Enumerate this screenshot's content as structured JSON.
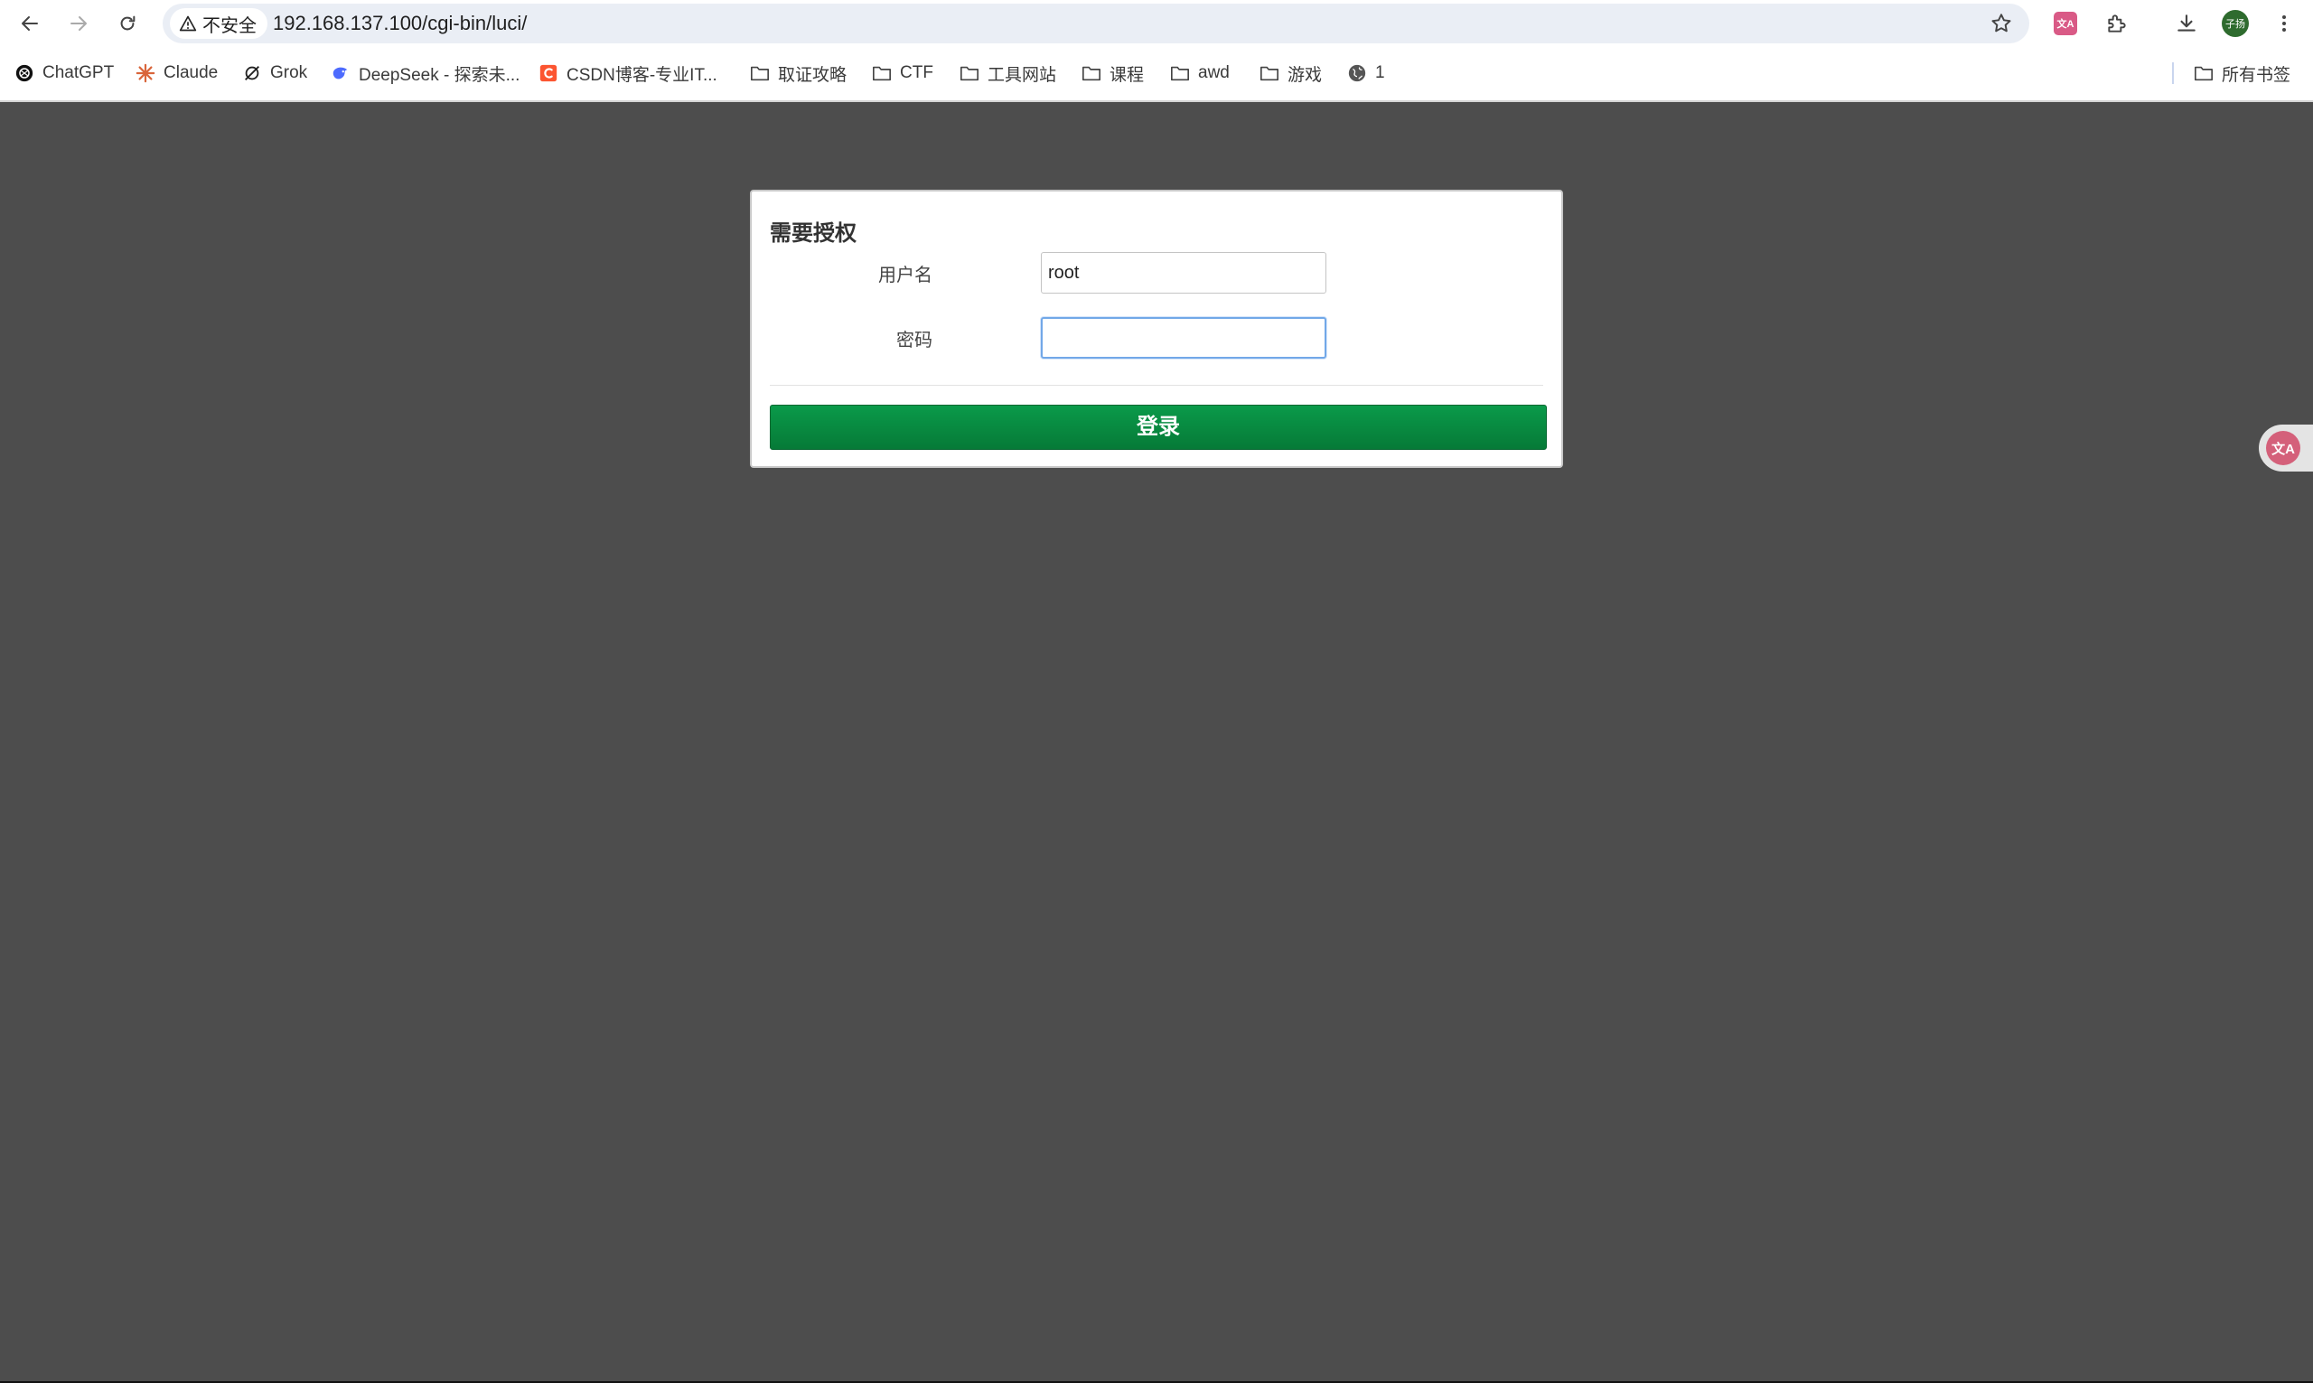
{
  "browser": {
    "security_label": "不安全",
    "url": "192.168.137.100/cgi-bin/luci/",
    "translate_ext_label": "文A",
    "profile_label": "子扬",
    "all_bookmarks_label": "所有书签"
  },
  "bookmarks": [
    {
      "label": "ChatGPT",
      "icon": "chatgpt-icon"
    },
    {
      "label": "Claude",
      "icon": "claude-icon"
    },
    {
      "label": "Grok",
      "icon": "grok-icon"
    },
    {
      "label": "DeepSeek - 探索未...",
      "icon": "deepseek-icon"
    },
    {
      "label": "CSDN博客-专业IT...",
      "icon": "csdn-icon"
    },
    {
      "label": "取证攻略",
      "icon": "folder-icon"
    },
    {
      "label": "CTF",
      "icon": "folder-icon"
    },
    {
      "label": "工具网站",
      "icon": "folder-icon"
    },
    {
      "label": "课程",
      "icon": "folder-icon"
    },
    {
      "label": "awd",
      "icon": "folder-icon"
    },
    {
      "label": "游戏",
      "icon": "folder-icon"
    },
    {
      "label": "1",
      "icon": "globe-icon"
    }
  ],
  "login": {
    "title": "需要授权",
    "username_label": "用户名",
    "username_value": "root",
    "password_label": "密码",
    "password_value": "",
    "submit_label": "登录"
  },
  "colors": {
    "page_background": "#4d4d4d",
    "button_green": "#088a3f",
    "focus_blue": "#72a8e8"
  }
}
